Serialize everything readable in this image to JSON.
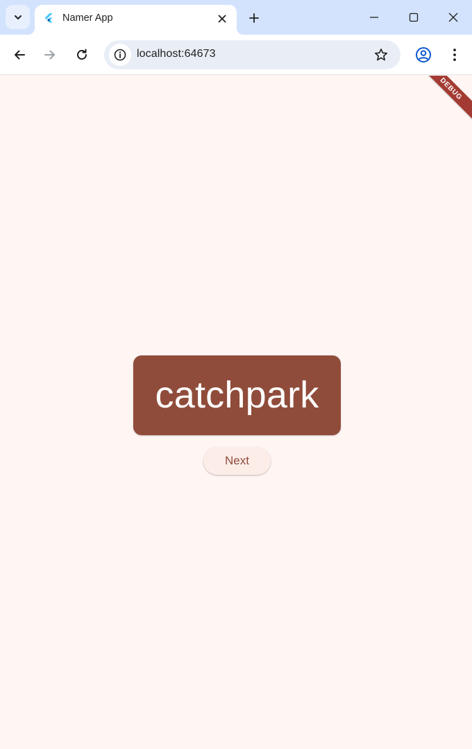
{
  "browser": {
    "tab": {
      "title": "Namer App",
      "favicon": "flutter-logo-icon"
    },
    "url": "localhost:64673",
    "icons": {
      "tab_search": "chevron-down-icon",
      "new_tab": "plus-icon",
      "minimize": "minimize-icon",
      "maximize": "maximize-icon",
      "close_window": "close-icon",
      "back": "back-arrow-icon",
      "forward": "forward-arrow-icon",
      "reload": "reload-icon",
      "site_info": "info-icon",
      "bookmark": "star-icon",
      "profile": "profile-icon",
      "menu": "kebab-menu-icon"
    },
    "colors": {
      "tabstrip": "#d3e3fd",
      "toolbar": "#ffffff",
      "omnibox": "#e9eef6"
    }
  },
  "app": {
    "current_word": "catchpark",
    "next_button_label": "Next",
    "debug_banner": "DEBUG",
    "colors": {
      "background": "#fff5f3",
      "card": "#904c3b",
      "card_text": "#ffffff",
      "button_bg": "#fcede9",
      "button_text": "#904c3b",
      "banner": "#a33b32"
    }
  }
}
